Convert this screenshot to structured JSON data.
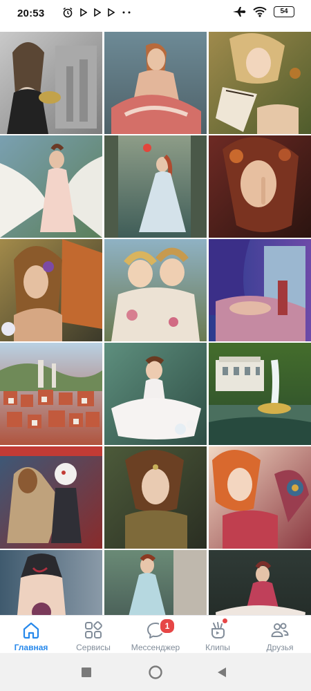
{
  "status_bar": {
    "time": "20:53",
    "battery": "54",
    "left_icons": [
      "alarm-icon",
      "play-icon",
      "play-icon",
      "play-icon",
      "more-dots-icon"
    ],
    "right_icons": [
      "airplane-mode-icon",
      "wifi-icon",
      "battery-icon"
    ]
  },
  "grid": {
    "photos": [
      {
        "name": "woman-with-mask-gray-puzzle"
      },
      {
        "name": "mermaid-puzzle"
      },
      {
        "name": "butterfly-fairy-puzzle"
      },
      {
        "name": "angel-wings-puzzle"
      },
      {
        "name": "forest-fairy-puzzle"
      },
      {
        "name": "autumn-woman-puzzle"
      },
      {
        "name": "fairy-portrait-puzzle"
      },
      {
        "name": "two-children-flowers-puzzle"
      },
      {
        "name": "sleeping-beauty-puzzle"
      },
      {
        "name": "fairytale-town-puzzle"
      },
      {
        "name": "ballerina-girl-puzzle"
      },
      {
        "name": "palace-fountain-puzzle"
      },
      {
        "name": "carousel-horse-clown-puzzle"
      },
      {
        "name": "woman-pendant-puzzle"
      },
      {
        "name": "red-hair-fairy-puzzle"
      },
      {
        "name": "tattooed-back-puzzle"
      },
      {
        "name": "girl-on-stairs-puzzle"
      },
      {
        "name": "fairy-on-rock-puzzle"
      }
    ]
  },
  "tabbar": {
    "tabs": [
      {
        "label": "Главная",
        "icon": "home-icon",
        "active": true
      },
      {
        "label": "Сервисы",
        "icon": "services-icon",
        "active": false
      },
      {
        "label": "Мессенджер",
        "icon": "messenger-icon",
        "active": false,
        "badge": "1"
      },
      {
        "label": "Клипы",
        "icon": "clips-icon",
        "active": false,
        "dot": true
      },
      {
        "label": "Друзья",
        "icon": "friends-icon",
        "active": false
      }
    ],
    "colors": {
      "active": "#2688eb",
      "inactive": "#818c99",
      "badge": "#e64646"
    }
  },
  "system_nav": {
    "buttons": [
      "recents-square-icon",
      "home-circle-icon",
      "back-triangle-icon"
    ]
  }
}
